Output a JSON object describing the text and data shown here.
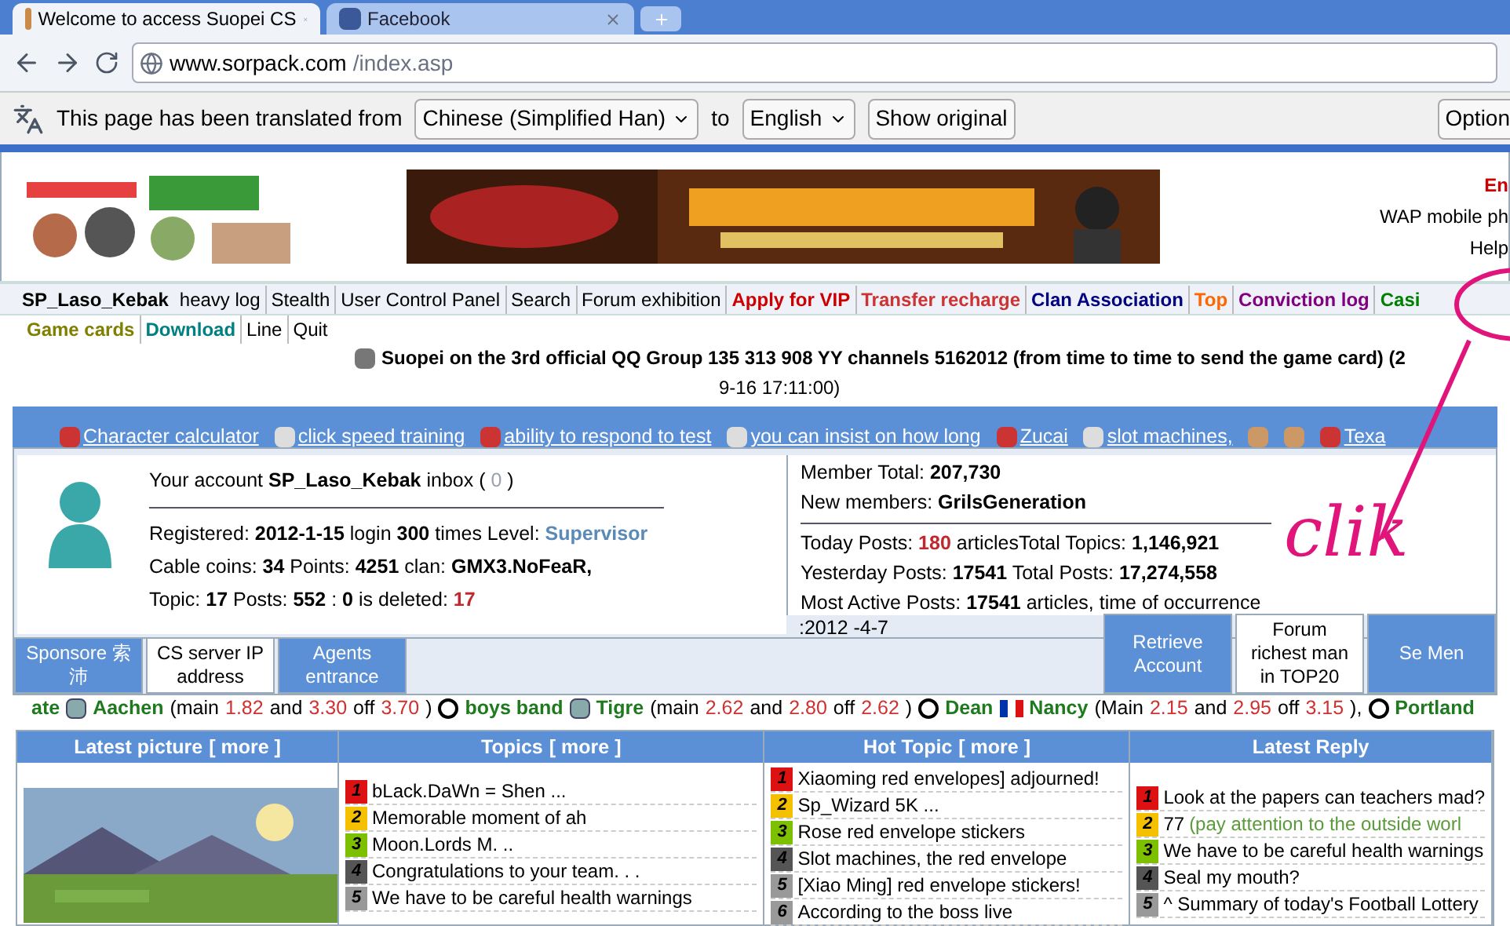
{
  "browser": {
    "tabs": [
      {
        "title": "Welcome to access Suopei CS",
        "selected": true
      },
      {
        "title": "Facebook",
        "selected": false
      }
    ],
    "url": {
      "host": "www.sorpack.com",
      "path": "/index.asp"
    },
    "translate_bar": {
      "message": "This page has been translated from",
      "from": "Chinese (Simplified Han)",
      "to_label": "to",
      "to": "English",
      "show_original": "Show original",
      "options": "Option"
    }
  },
  "header": {
    "right_links": [
      {
        "text": "En",
        "color": "#cc0000"
      },
      {
        "text": "WAP mobile ph",
        "color": "#000000"
      },
      {
        "text": "Help",
        "color": "#000000"
      }
    ]
  },
  "nav": {
    "user": "SP_Laso_Kebak",
    "items": [
      {
        "text": "heavy log",
        "color": "#000000",
        "bold": false
      },
      {
        "text": "Stealth",
        "color": "#000000",
        "bold": false
      },
      {
        "text": "User Control Panel",
        "color": "#000000",
        "bold": false
      },
      {
        "text": "Search",
        "color": "#000000",
        "bold": false
      },
      {
        "text": "Forum exhibition",
        "color": "#000000",
        "bold": false
      },
      {
        "text": "Apply for VIP",
        "color": "#cc0000",
        "bold": true
      },
      {
        "text": "Transfer recharge",
        "color": "#cc3333",
        "bold": true
      },
      {
        "text": "Clan Association",
        "color": "#000080",
        "bold": true
      },
      {
        "text": "Top",
        "color": "#ff6600",
        "bold": true
      },
      {
        "text": "Conviction log",
        "color": "#800080",
        "bold": true
      },
      {
        "text": "Casi",
        "color": "#008000",
        "bold": true
      }
    ]
  },
  "links": [
    {
      "text": "Game cards",
      "color": "#808000",
      "bold": true
    },
    {
      "text": "Download",
      "color": "#008080",
      "bold": true
    },
    {
      "text": "Line",
      "color": "#000000",
      "bold": false
    },
    {
      "text": "Quit",
      "color": "#000000",
      "bold": false
    }
  ],
  "announcement": [
    "Suopei on the 3rd official QQ Group 135 313 908 YY channels 5162012 (from time to time to send the game card) (2",
    "9-16 17:11:00)"
  ],
  "tools": [
    {
      "kind": "link",
      "text": "Character calculator"
    },
    {
      "kind": "link",
      "text": "click speed training"
    },
    {
      "kind": "link",
      "text": "ability to respond to test"
    },
    {
      "kind": "link",
      "text": "you can insist on how long"
    },
    {
      "kind": "link",
      "text": "Zucai"
    },
    {
      "kind": "link",
      "text": "slot machines,"
    },
    {
      "kind": "icon"
    },
    {
      "kind": "icon"
    },
    {
      "kind": "link",
      "text": "Texa"
    }
  ],
  "account": {
    "lines": [
      [
        {
          "t": "Your account ",
          "kind": "plain"
        },
        {
          "t": "SP_Laso_Kebak",
          "kind": "bold"
        },
        {
          "t": " inbox ( ",
          "kind": "plain"
        },
        {
          "t": "0",
          "kind": "gray"
        },
        {
          "t": " )",
          "kind": "plain"
        }
      ],
      [
        {
          "t": "Registered: ",
          "kind": "plain"
        },
        {
          "t": "2012-1-15",
          "kind": "bold"
        },
        {
          "t": " login ",
          "kind": "plain"
        },
        {
          "t": "300",
          "kind": "bold"
        },
        {
          "t": " times Level: ",
          "kind": "plain"
        },
        {
          "t": "Supervisor",
          "kind": "link"
        }
      ],
      [
        {
          "t": "Cable coins: ",
          "kind": "plain"
        },
        {
          "t": "34",
          "kind": "bold"
        },
        {
          "t": " Points: ",
          "kind": "plain"
        },
        {
          "t": "4251",
          "kind": "bold"
        },
        {
          "t": " clan: ",
          "kind": "plain"
        },
        {
          "t": "GMX3.NoFeaR,",
          "kind": "bold"
        }
      ],
      [
        {
          "t": "Topic: ",
          "kind": "plain"
        },
        {
          "t": "17",
          "kind": "bold"
        },
        {
          "t": " Posts: ",
          "kind": "plain"
        },
        {
          "t": "552",
          "kind": "bold"
        },
        {
          "t": " : ",
          "kind": "plain"
        },
        {
          "t": "0",
          "kind": "bold"
        },
        {
          "t": " is deleted: ",
          "kind": "plain"
        },
        {
          "t": "17",
          "kind": "redbold"
        }
      ]
    ]
  },
  "stats": {
    "top": [
      [
        {
          "t": "Member Total: ",
          "kind": "plain"
        },
        {
          "t": "207,730",
          "kind": "bold"
        }
      ],
      [
        {
          "t": "New members: ",
          "kind": "plain"
        },
        {
          "t": "GrilsGeneration",
          "kind": "bold"
        }
      ]
    ],
    "bottom": [
      [
        {
          "t": "Today Posts: ",
          "kind": "plain"
        },
        {
          "t": "180",
          "kind": "redbold"
        },
        {
          "t": " articlesTotal Topics: ",
          "kind": "plain"
        },
        {
          "t": "1,146,921",
          "kind": "bold"
        }
      ],
      [
        {
          "t": "Yesterday Posts: ",
          "kind": "plain"
        },
        {
          "t": "17541",
          "kind": "bold"
        },
        {
          "t": " Total Posts: ",
          "kind": "plain"
        },
        {
          "t": "17,274,558",
          "kind": "bold"
        }
      ],
      [
        {
          "t": "Most Active Posts: ",
          "kind": "plain"
        },
        {
          "t": "17541",
          "kind": "bold"
        },
        {
          "t": " articles, time of occurrence",
          "kind": "plain"
        }
      ]
    ],
    "date": ":2012 -4-7"
  },
  "left_tabs": [
    {
      "label": "Sponsore 索沛",
      "selected": false
    },
    {
      "label": "CS server IP address",
      "selected": true
    },
    {
      "label": "Agents entrance",
      "selected": false
    }
  ],
  "right_tabs": [
    {
      "label": "Retrieve Account",
      "selected": false
    },
    {
      "label": "Forum richest man in TOP20",
      "selected": true
    },
    {
      "label": "Se Men",
      "selected": false
    }
  ],
  "ticker": [
    {
      "kind": "green",
      "t": "ate"
    },
    {
      "kind": "icon"
    },
    {
      "kind": "green",
      "t": "Aachen"
    },
    {
      "kind": "plain",
      "t": "(main"
    },
    {
      "kind": "red",
      "t": "1.82"
    },
    {
      "kind": "plain",
      "t": "and"
    },
    {
      "kind": "red",
      "t": "3.30"
    },
    {
      "kind": "plain",
      "t": "off"
    },
    {
      "kind": "red",
      "t": "3.70"
    },
    {
      "kind": "plain",
      "t": ")"
    },
    {
      "kind": "ball"
    },
    {
      "kind": "green",
      "t": "boys band"
    },
    {
      "kind": "icon"
    },
    {
      "kind": "green",
      "t": "Tigre"
    },
    {
      "kind": "plain",
      "t": "(main"
    },
    {
      "kind": "red",
      "t": "2.62"
    },
    {
      "kind": "plain",
      "t": "and"
    },
    {
      "kind": "red",
      "t": "2.80"
    },
    {
      "kind": "plain",
      "t": "off"
    },
    {
      "kind": "red",
      "t": "2.62"
    },
    {
      "kind": "plain",
      "t": ")"
    },
    {
      "kind": "ball"
    },
    {
      "kind": "green",
      "t": "Dean"
    },
    {
      "kind": "flag"
    },
    {
      "kind": "green",
      "t": "Nancy"
    },
    {
      "kind": "plain",
      "t": "(Main"
    },
    {
      "kind": "red",
      "t": "2.15"
    },
    {
      "kind": "plain",
      "t": "and"
    },
    {
      "kind": "red",
      "t": "2.95"
    },
    {
      "kind": "plain",
      "t": "off"
    },
    {
      "kind": "red",
      "t": "3.15"
    },
    {
      "kind": "plain",
      "t": "),"
    },
    {
      "kind": "ball"
    },
    {
      "kind": "green",
      "t": "Portland"
    }
  ],
  "columns": [
    {
      "title": "Latest picture",
      "more": "[ more ]",
      "kind": "picture"
    },
    {
      "title": "Topics",
      "more": "[ more ]",
      "kind": "list",
      "items": [
        {
          "rank": "1",
          "color": "#dd1111",
          "text": "bLack.DaWn = Shen ..."
        },
        {
          "rank": "2",
          "color": "#f5c000",
          "text": "Memorable moment of ah"
        },
        {
          "rank": "3",
          "color": "#7cc000",
          "text": "Moon.Lords M. .."
        },
        {
          "rank": "4",
          "color": "#555555",
          "text": "Congratulations to your team. . ."
        },
        {
          "rank": "5",
          "color": "#999999",
          "text": "We have to be careful health warnings"
        }
      ]
    },
    {
      "title": "Hot Topic",
      "more": "[ more ]",
      "kind": "list",
      "items": [
        {
          "rank": "1",
          "color": "#dd1111",
          "text": "Xiaoming red envelopes] adjourned!"
        },
        {
          "rank": "2",
          "color": "#f5c000",
          "text": "Sp_Wizard 5K ..."
        },
        {
          "rank": "3",
          "color": "#7cc000",
          "text": "Rose red envelope stickers"
        },
        {
          "rank": "4",
          "color": "#555555",
          "text": "Slot machines, the red envelope"
        },
        {
          "rank": "5",
          "color": "#999999",
          "text": "[Xiao Ming] red envelope stickers!"
        },
        {
          "rank": "6",
          "color": "#999999",
          "text": "According to the boss live"
        }
      ]
    },
    {
      "title": "Latest Reply",
      "kind": "list",
      "items": [
        {
          "rank": "1",
          "color": "#dd1111",
          "text": "Look at the papers can teachers mad?"
        },
        {
          "rank": "2",
          "color": "#f5c000",
          "text": "77",
          "note": "(pay attention to the outside worl"
        },
        {
          "rank": "3",
          "color": "#7cc000",
          "text": "We have to be careful health warnings"
        },
        {
          "rank": "4",
          "color": "#555555",
          "text": "Seal my mouth?"
        },
        {
          "rank": "5",
          "color": "#999999",
          "text": "^ Summary of today's Football Lottery"
        }
      ]
    }
  ],
  "annotation": "clik"
}
